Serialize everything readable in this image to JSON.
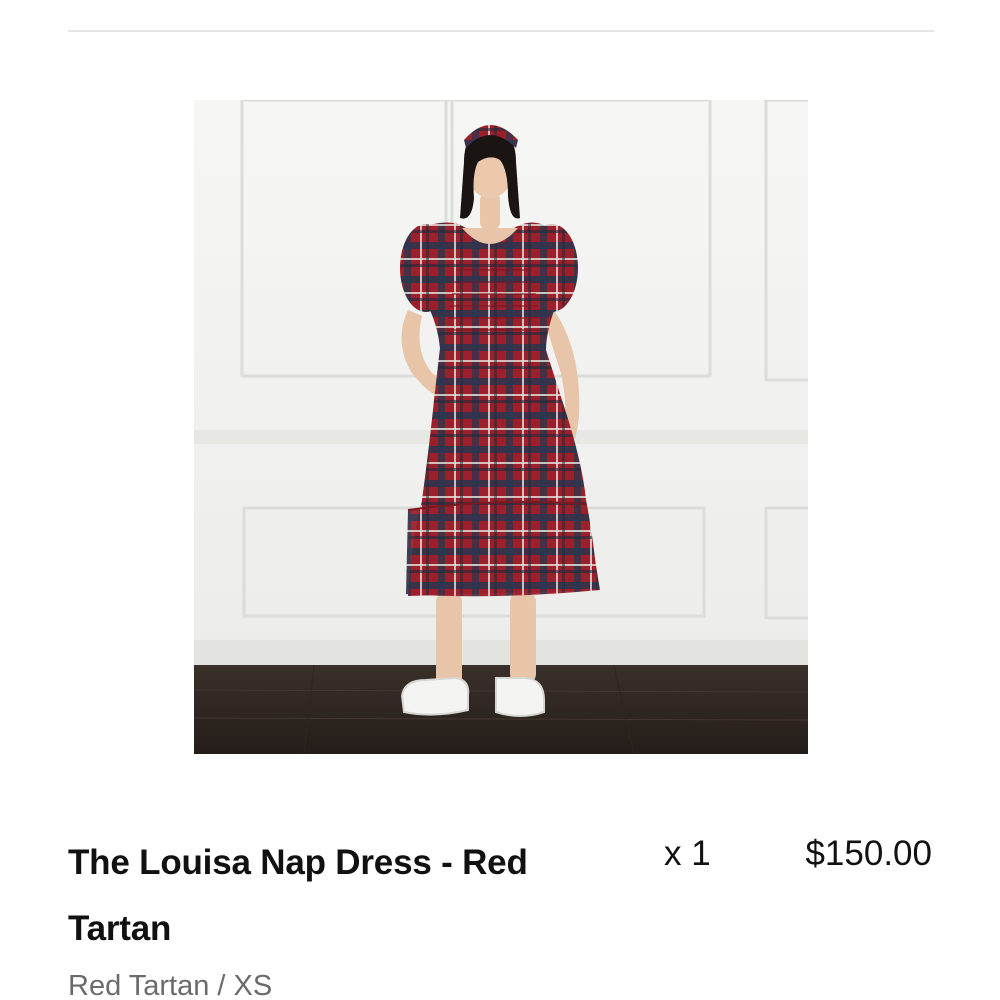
{
  "cart_item": {
    "title": "The Louisa Nap Dress - Red Tartan",
    "quantity": "x 1",
    "price": "$150.00",
    "variant": "Red Tartan / XS"
  },
  "image": {
    "subject": "model wearing red tartan smocked midi dress with puff sleeves, white sneakers, against white paneled wall and dark wood floor"
  },
  "colors": {
    "divider": "#e6e6e6",
    "text_primary": "#111111",
    "text_secondary": "#6b6b6b",
    "dress_red": "#9c1f2b",
    "floor": "#2c2520"
  }
}
